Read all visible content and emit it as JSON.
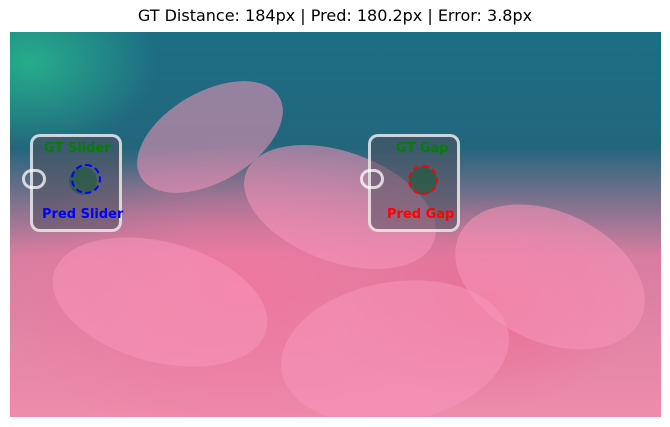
{
  "title": "GT Distance: 184px | Pred: 180.2px | Error: 3.8px",
  "labels": {
    "gt_slider": "GT Slider",
    "pred_slider": "Pred Slider",
    "gt_gap": "GT Gap",
    "pred_gap": "Pred Gap"
  },
  "colors": {
    "gt": "#008000",
    "pred_slider": "#0000ff",
    "pred_gap": "#ff0000"
  }
}
